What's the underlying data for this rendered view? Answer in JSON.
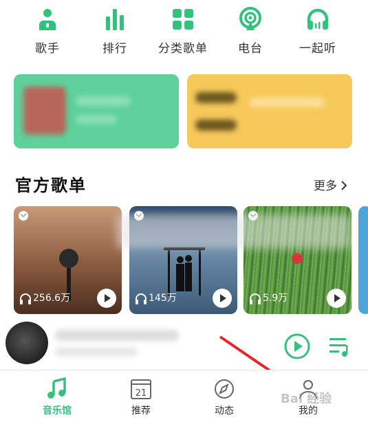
{
  "categories": [
    {
      "label": "歌手",
      "icon": "singer-icon"
    },
    {
      "label": "排行",
      "icon": "ranking-bars-icon"
    },
    {
      "label": "分类歌单",
      "icon": "category-grid-icon"
    },
    {
      "label": "电台",
      "icon": "radio-icon"
    },
    {
      "label": "一起听",
      "icon": "headphones-icon"
    }
  ],
  "section": {
    "title": "官方歌单",
    "more": "更多"
  },
  "playlists": [
    {
      "count": "256.6万"
    },
    {
      "count": "145万"
    },
    {
      "count": "5.9万"
    }
  ],
  "tabs": [
    {
      "label": "音乐馆",
      "icon": "music-note-icon",
      "active": true
    },
    {
      "label": "推荐",
      "icon": "calendar-icon",
      "date": "21",
      "active": false
    },
    {
      "label": "动态",
      "icon": "compass-icon",
      "active": false
    },
    {
      "label": "我的",
      "icon": "user-icon",
      "active": false
    }
  ],
  "colors": {
    "accent": "#31c27c",
    "banner_green": "#5ed19a",
    "banner_yellow": "#f7c95a",
    "arrow": "#e8262a"
  },
  "watermark": "Bai 经验"
}
